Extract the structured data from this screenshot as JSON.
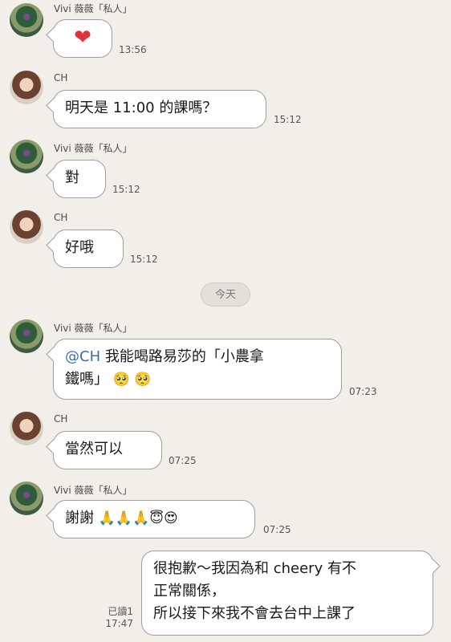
{
  "chat": {
    "day_separator": "今天",
    "messages": [
      {
        "sender": "Vivi 薇薇「私人」",
        "text": "❤",
        "time": "13:56"
      },
      {
        "sender": "CH",
        "text": "明天是 11:00 的課嗎？",
        "time": "15:12"
      },
      {
        "sender": "Vivi 薇薇「私人」",
        "text": "對",
        "time": "15:12"
      },
      {
        "sender": "CH",
        "text": "好哦",
        "time": "15:12"
      },
      {
        "sender": "Vivi 薇薇「私人」",
        "mention": "@CH",
        "text_line1": " 我能喝路易莎的「小農拿",
        "text_line2": "鐵嗎」",
        "emoji": "🥺 🥺",
        "time": "07:23"
      },
      {
        "sender": "CH",
        "text": "當然可以",
        "time": "07:25"
      },
      {
        "sender": "Vivi 薇薇「私人」",
        "text": "謝謝",
        "emoji": "🙏🙏🙏😇😍",
        "time": "07:25"
      },
      {
        "sender": "me",
        "line1": "很抱歉～我因為和 cheery 有不",
        "line2": "正常關係，",
        "line3": "所以接下來我不會去台中上課了",
        "read": "已讀1",
        "time": "17:47"
      }
    ]
  }
}
